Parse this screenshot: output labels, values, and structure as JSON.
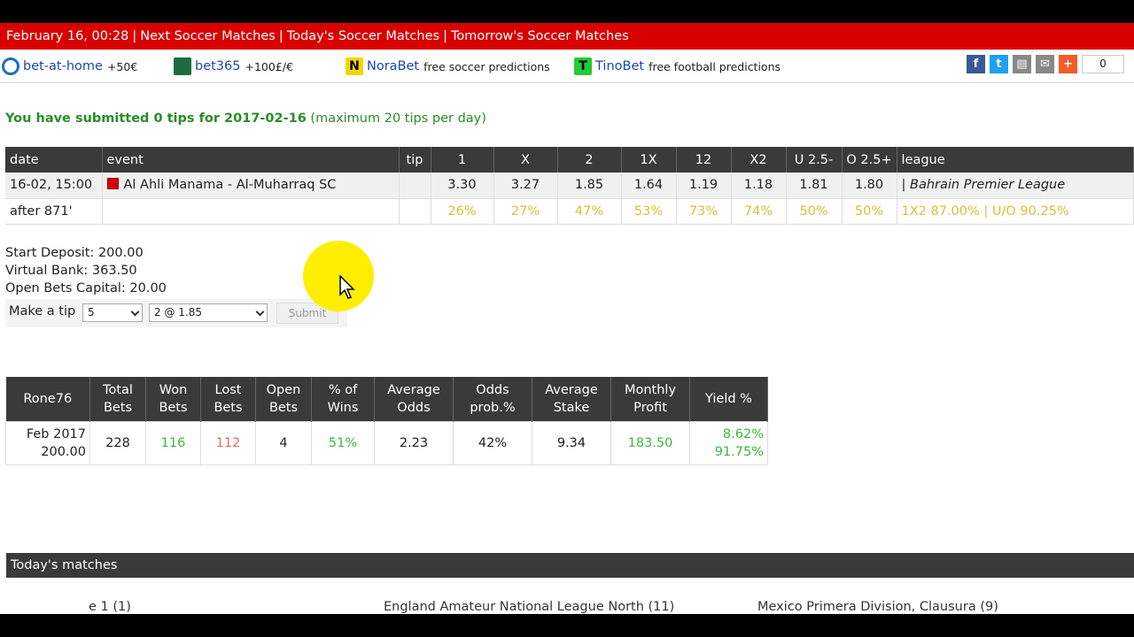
{
  "topbar": {
    "datetime": "February 16, 00:28",
    "links": [
      "Next Soccer Matches",
      "Today's Soccer Matches",
      "Tomorrow's Soccer Matches"
    ]
  },
  "sponsors": [
    {
      "name": "bet-at-home",
      "extra": "+50€",
      "icon": "bet-at-home-logo"
    },
    {
      "name": "bet365",
      "extra": "+100£/€",
      "icon": "bet365-logo"
    },
    {
      "name": "NoraBet",
      "extra": "free soccer predictions",
      "icon": "norabet-logo"
    },
    {
      "name": "TinoBet",
      "extra": "free football predictions",
      "icon": "tinobet-logo"
    }
  ],
  "social": {
    "count": "0",
    "icons": [
      "facebook-icon",
      "twitter-icon",
      "print-icon",
      "email-icon",
      "plus-icon"
    ]
  },
  "message": {
    "prefix": "You have submitted 0 tips for 2017-02-16",
    "suffix": "(maximum 20 tips per day)"
  },
  "matches": {
    "headers": [
      "date",
      "event",
      "tip",
      "1",
      "X",
      "2",
      "1X",
      "12",
      "X2",
      "U 2.5-",
      "O 2.5+",
      "league"
    ],
    "row1": {
      "date": "16-02, 15:00",
      "event": "Al Ahli Manama - Al-Muharraq SC",
      "tip": "",
      "odds": [
        "3.30",
        "3.27",
        "1.85",
        "1.64",
        "1.19",
        "1.18",
        "1.81",
        "1.80"
      ],
      "league": "| Bahrain Premier League"
    },
    "row2": {
      "date": "after 871'",
      "event": "",
      "tip": "",
      "pcts": [
        "26%",
        "27%",
        "47%",
        "53%",
        "73%",
        "74%",
        "50%",
        "50%"
      ],
      "league": "1X2 87.00% | U/O 90.25%"
    }
  },
  "bank": {
    "start_deposit": "Start Deposit: 200.00",
    "virtual_bank": "Virtual Bank: 363.50",
    "open_bets": "Open Bets Capital: 20.00"
  },
  "tip_form": {
    "label": "Make a tip",
    "stake_value": "5",
    "pick_value": "2 @ 1.85",
    "submit": "Submit"
  },
  "stats": {
    "headers": [
      [
        "Rone76"
      ],
      [
        "Total",
        "Bets"
      ],
      [
        "Won",
        "Bets"
      ],
      [
        "Lost",
        "Bets"
      ],
      [
        "Open",
        "Bets"
      ],
      [
        "% of",
        "Wins"
      ],
      [
        "Average",
        "Odds"
      ],
      [
        "Odds",
        "prob.%"
      ],
      [
        "Average",
        "Stake"
      ],
      [
        "Monthly",
        "Profit"
      ],
      [
        "Yield %"
      ]
    ],
    "row": {
      "period": "Feb 2017",
      "period_value": "200.00",
      "total": "228",
      "won": "116",
      "lost": "112",
      "open": "4",
      "pct_wins": "51%",
      "avg_odds": "2.23",
      "odds_prob": "42%",
      "avg_stake": "9.34",
      "profit": "183.50",
      "yield1": "8.62%",
      "yield2": "91.75%"
    }
  },
  "today": {
    "title": "Today's matches",
    "leagues": [
      "e 1 (1)",
      "England Amateur National League North (11)",
      "Mexico Primera Division, Clausura (9)"
    ]
  }
}
